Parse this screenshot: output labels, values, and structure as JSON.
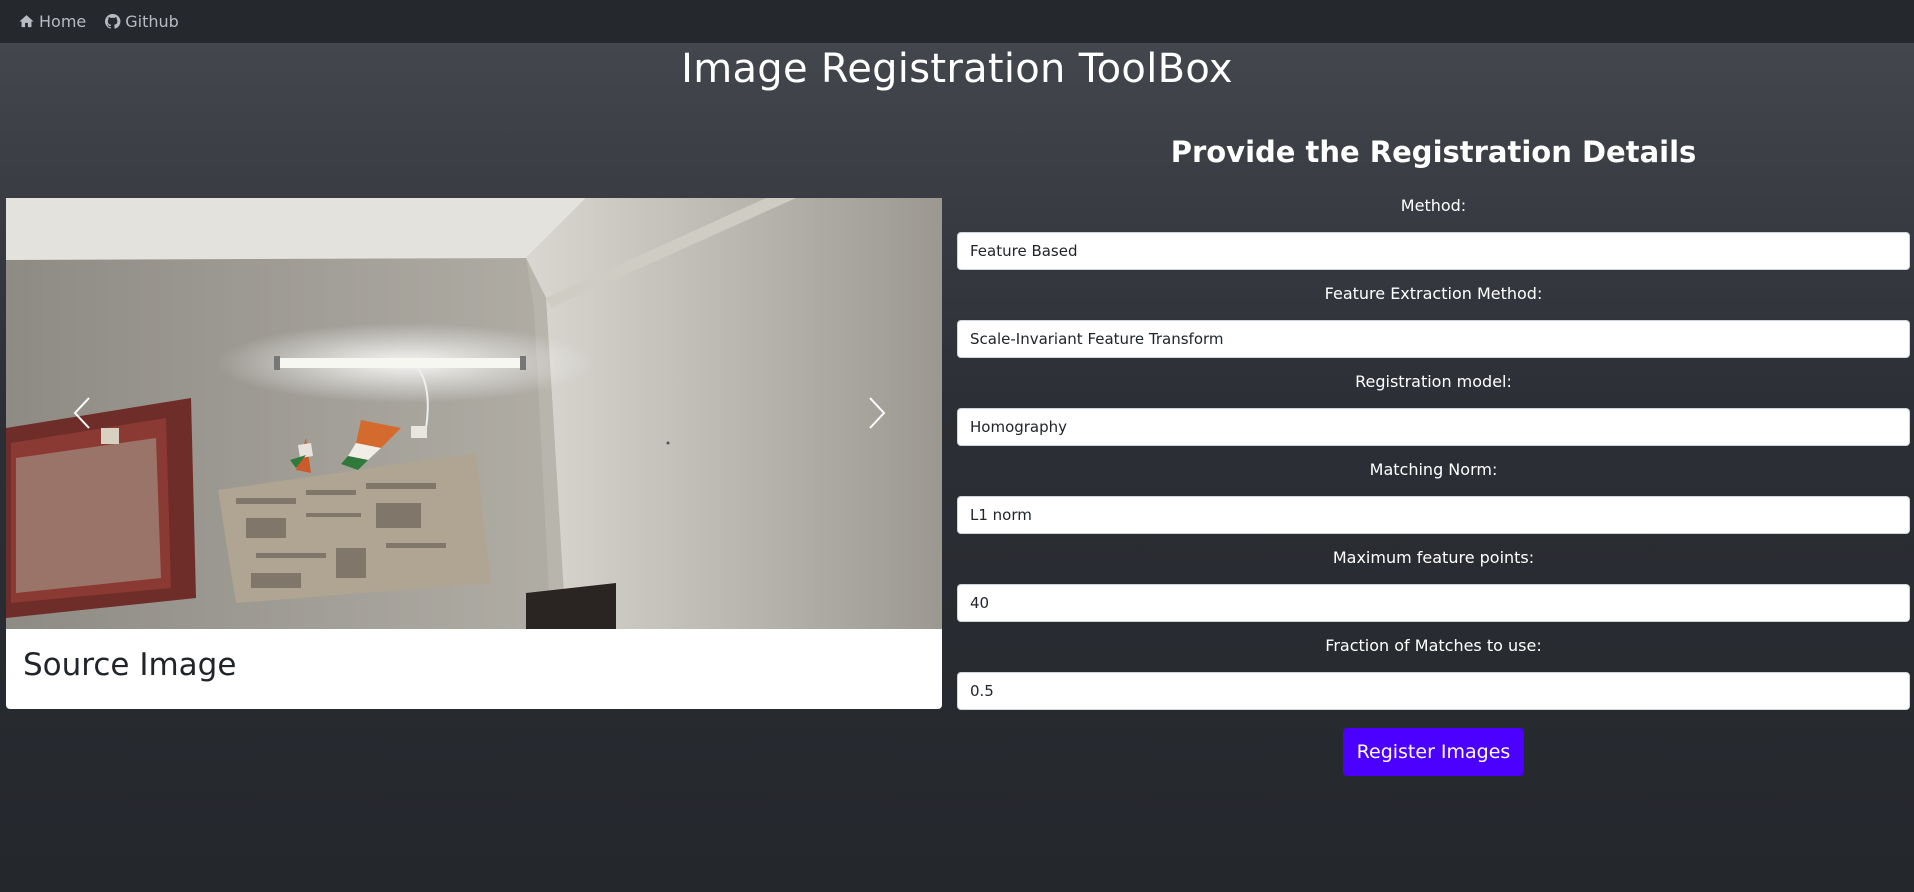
{
  "nav": {
    "home_label": "Home",
    "github_label": "Github",
    "home_icon": "home-icon",
    "github_icon": "github-icon"
  },
  "page_title": "Image Registration ToolBox",
  "carousel": {
    "caption": "Source Image",
    "prev_icon": "chevron-left-icon",
    "next_icon": "chevron-right-icon"
  },
  "form": {
    "heading": "Provide the Registration Details",
    "fields": [
      {
        "label": "Method:",
        "value": "Feature Based"
      },
      {
        "label": "Feature Extraction Method:",
        "value": "Scale-Invariant Feature Transform"
      },
      {
        "label": "Registration model:",
        "value": "Homography"
      },
      {
        "label": "Matching Norm:",
        "value": "L1 norm"
      },
      {
        "label": "Maximum feature points:",
        "value": "40"
      },
      {
        "label": "Fraction of Matches to use:",
        "value": "0.5"
      }
    ],
    "submit_label": "Register Images"
  },
  "colors": {
    "navbar_bg": "#25282d",
    "accent": "#4c00ff",
    "page_bg": "#2c2f35"
  }
}
